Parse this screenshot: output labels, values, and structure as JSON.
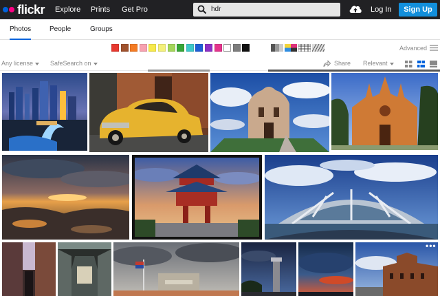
{
  "header": {
    "logo": "flickr",
    "nav": [
      "Explore",
      "Prints",
      "Get Pro"
    ],
    "search": {
      "query": "hdr"
    },
    "login_label": "Log In",
    "signup_label": "Sign Up",
    "bar_color": "#212124",
    "signup_color": "#128fdc"
  },
  "tabs": [
    {
      "label": "Photos",
      "active": true
    },
    {
      "label": "People",
      "active": false
    },
    {
      "label": "Groups",
      "active": false
    }
  ],
  "color_filters": [
    "#e7392f",
    "#a0522d",
    "#f47b24",
    "#f7a1b0",
    "#f7e94b",
    "#f3f07a",
    "#a3d55a",
    "#37a537",
    "#3ec8c9",
    "#1e5ed6",
    "#8d2fc5",
    "#e4348c",
    "#ffffff",
    "#7c7c7c",
    "#111111"
  ],
  "style_filters": [
    "desaturated-icon",
    "pop-art-icon",
    "pattern-icon",
    "minimal-icon"
  ],
  "advanced_label": "Advanced",
  "filters": {
    "license": "Any license",
    "safesearch": "SafeSearch on",
    "share": "Share",
    "sort": "Relevant"
  },
  "photos": [
    {
      "name": "singapore-skyline-fountain"
    },
    {
      "name": "yellow-vintage-car"
    },
    {
      "name": "ornate-building-clouds"
    },
    {
      "name": "gothic-church-orange"
    },
    {
      "name": "sunset-seascape-rocks"
    },
    {
      "name": "chinese-pagoda"
    },
    {
      "name": "modern-pavilion-fisheye"
    },
    {
      "name": "narrow-alley"
    },
    {
      "name": "arcade-corridor"
    },
    {
      "name": "flag-building-stormy-sky"
    },
    {
      "name": "tower-night-sky"
    },
    {
      "name": "dramatic-sunset-clouds"
    },
    {
      "name": "brick-castle-building"
    }
  ]
}
